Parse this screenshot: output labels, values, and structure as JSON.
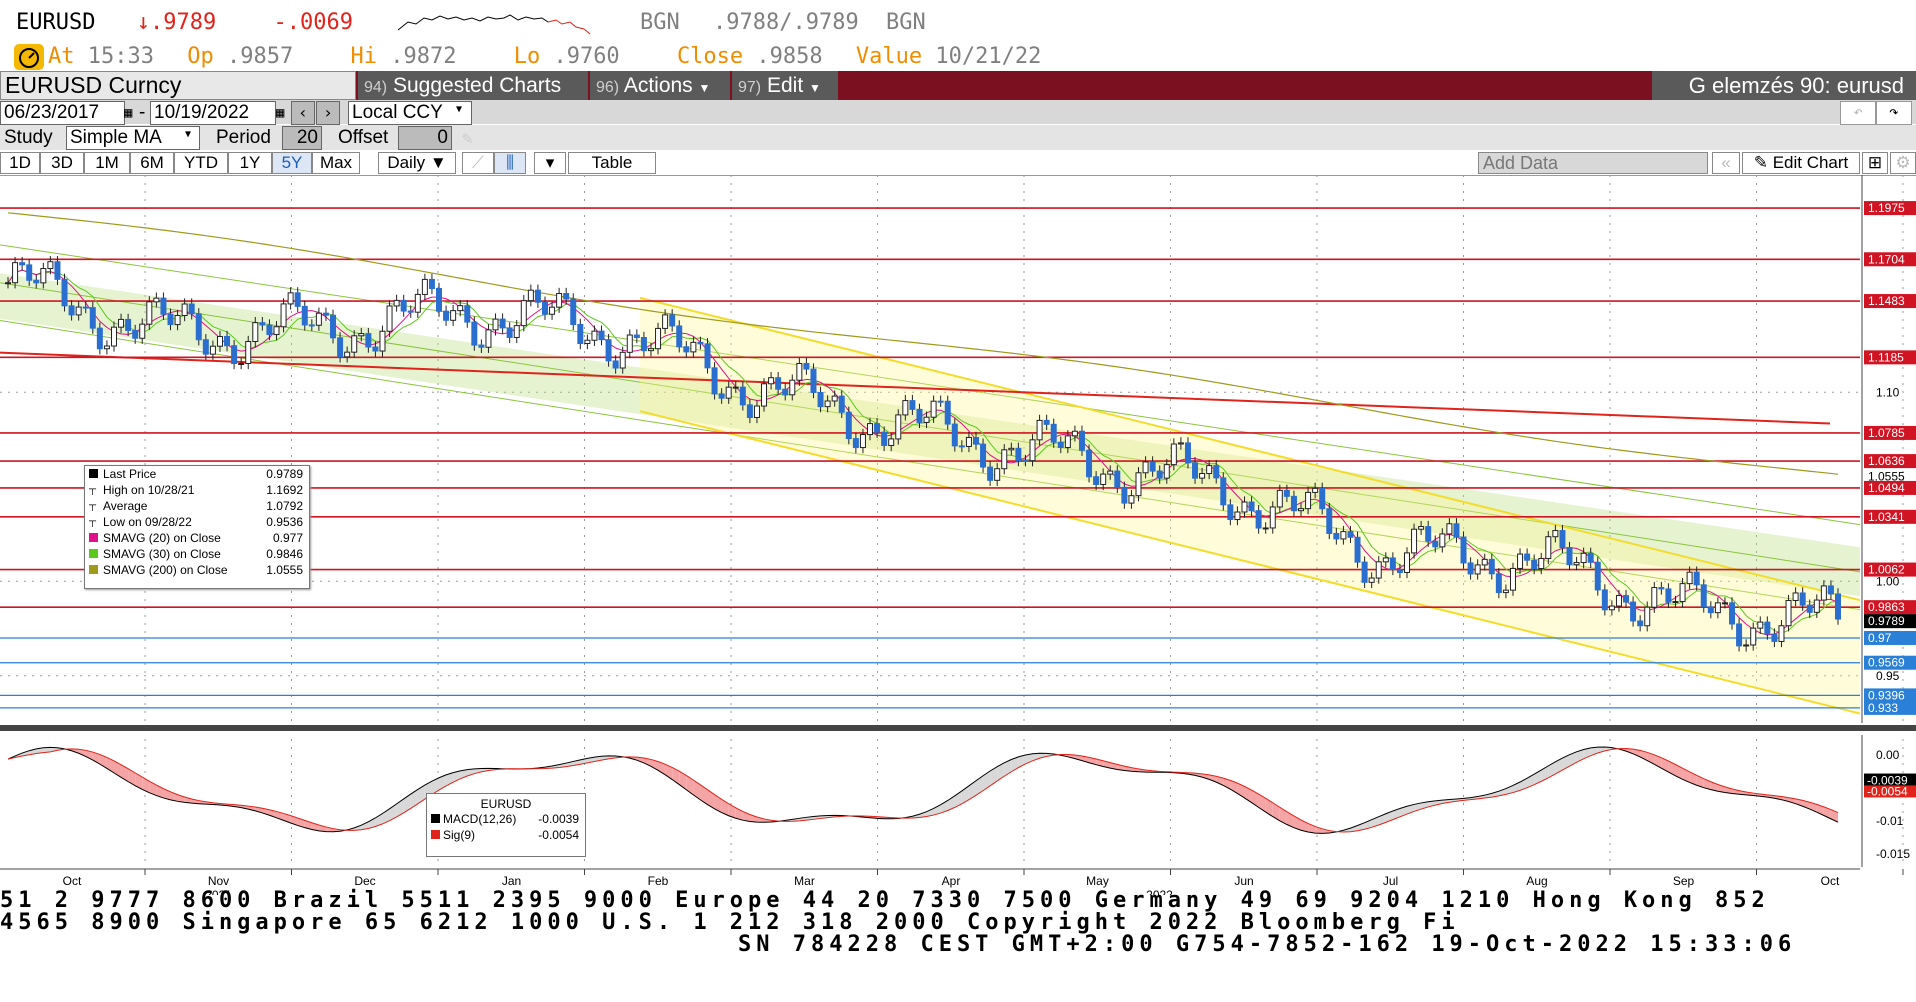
{
  "header": {
    "ticker": "EURUSD",
    "arrow": "↓",
    "last": ".9789",
    "change": "-.0069",
    "source1": "BGN",
    "bid": ".9788",
    "slash": "/",
    "ask": ".9789",
    "source2": "BGN",
    "at_label": "At",
    "at_time": "15:33",
    "op_label": "Op",
    "op_value": ".9857",
    "hi_label": "Hi",
    "hi_value": ".9872",
    "lo_label": "Lo",
    "lo_value": ".9760",
    "close_label": "Close",
    "close_value": ".9858",
    "value_label": "Value",
    "value_date": "10/21/22"
  },
  "menubar": {
    "security": "EURUSD Curncy",
    "suggested_num": "94)",
    "suggested": "Suggested Charts",
    "actions_num": "96)",
    "actions": "Actions",
    "edit_num": "97)",
    "edit": "Edit",
    "title": "G elemzés 90: eurusd"
  },
  "controls": {
    "start_date": "06/23/2017",
    "dash": "-",
    "end_date": "10/19/2022",
    "currency": "Local CCY",
    "study_label": "Study",
    "study_value": "Simple MA",
    "period_label": "Period",
    "period_value": "20",
    "offset_label": "Offset",
    "offset_value": "0"
  },
  "toolbar": {
    "ranges": [
      "1D",
      "3D",
      "1M",
      "6M",
      "YTD",
      "1Y",
      "5Y",
      "Max"
    ],
    "selected_range": "5Y",
    "frequency": "Daily",
    "table": "Table",
    "add_data_placeholder": "Add Data",
    "edit_chart": "Edit Chart"
  },
  "colors": {
    "accent_red": "#e0231b",
    "menu_bar": "#7b1020",
    "selected_tab": "#1c5fb8",
    "hline_red": "#d01423",
    "hline_blue": "#2a7fd6",
    "up_candle": "#1a1a1a",
    "down_candle": "#2a6fd0"
  },
  "chart_data": {
    "type": "line",
    "price_axis_ticks": [
      "1.10",
      "1.00",
      "0.95"
    ],
    "macd_axis_ticks": [
      "0.00",
      "-0.01",
      "-0.015"
    ],
    "x_tick_labels": [
      "Oct",
      "Nov",
      "Dec",
      "Jan",
      "Feb",
      "Mar",
      "Apr",
      "May",
      "Jun",
      "Jul",
      "Aug",
      "Sep",
      "Oct"
    ],
    "x_year_labels": [
      "2021",
      "2022"
    ],
    "horizontal_levels": [
      {
        "label": "1.1975",
        "value": 1.1975,
        "color": "red"
      },
      {
        "label": "1.1704",
        "value": 1.1704,
        "color": "red"
      },
      {
        "label": "1.1483",
        "value": 1.1483,
        "color": "red"
      },
      {
        "label": "1.1185",
        "value": 1.1185,
        "color": "red"
      },
      {
        "label": "1.0785",
        "value": 1.0785,
        "color": "red"
      },
      {
        "label": "1.0636",
        "value": 1.0636,
        "color": "red"
      },
      {
        "label": "1.0494",
        "value": 1.0494,
        "color": "red"
      },
      {
        "label": "1.0341",
        "value": 1.0341,
        "color": "red"
      },
      {
        "label": "1.0062",
        "value": 1.0062,
        "color": "red"
      },
      {
        "label": "0.9863",
        "value": 0.9863,
        "color": "red"
      },
      {
        "label": "0.97",
        "value": 0.97,
        "color": "blue"
      },
      {
        "label": "0.9569",
        "value": 0.9569,
        "color": "blue"
      },
      {
        "label": "0.9396",
        "value": 0.9396,
        "color": "blue"
      },
      {
        "label": "0.933",
        "value": 0.933,
        "color": "blue"
      }
    ],
    "price_labels_extra": [
      {
        "label": "1.0555",
        "value": 1.0555
      },
      {
        "label": "0.9789",
        "value": 0.9789
      }
    ],
    "close_series_monthly": {
      "months": [
        "Oct 2021",
        "Nov 2021",
        "Dec 2021",
        "Jan 2022",
        "Feb 2022",
        "Mar 2022",
        "Apr 2022",
        "May 2022",
        "Jun 2022",
        "Jul 2022",
        "Aug 2022",
        "Sep 2022",
        "Oct 2022"
      ],
      "values": [
        1.158,
        1.132,
        1.133,
        1.143,
        1.132,
        1.1,
        1.08,
        1.065,
        1.05,
        1.015,
        1.012,
        0.985,
        0.9789
      ]
    },
    "legend": [
      {
        "name": "Last Price",
        "value": "0.9789",
        "color": "#000000"
      },
      {
        "name": "High on 10/28/21",
        "value": "1.1692",
        "color": ""
      },
      {
        "name": "Average",
        "value": "1.0792",
        "color": ""
      },
      {
        "name": "Low on 09/28/22",
        "value": "0.9536",
        "color": ""
      },
      {
        "name": "SMAVG (20)  on Close",
        "value": "0.977",
        "color": "#e0118a"
      },
      {
        "name": "SMAVG (30)  on Close",
        "value": "0.9846",
        "color": "#5cc81e"
      },
      {
        "name": "SMAVG (200)  on Close",
        "value": "1.0555",
        "color": "#9e9a1c"
      }
    ],
    "macd_legend": {
      "title": "EURUSD",
      "items": [
        {
          "name": "MACD(12,26)",
          "value": "-0.0039",
          "color": "#000000"
        },
        {
          "name": "Sig(9)",
          "value": "-0.0054",
          "color": "#e0231b"
        }
      ]
    },
    "macd_labels": [
      "-0.0039",
      "-0.0054"
    ]
  },
  "footer": {
    "line1": "51 2 9777 8600 Brazil 5511 2395 9000 Europe 44 20 7330 7500 Germany 49 69 9204 1210 Hong Kong 852",
    "line2": " 4565 8900       Singapore 65 6212 1000       U.S. 1 212 318 2000       Copyright 2022 Bloomberg Fi",
    "line3": "SN 784228 CEST GMT+2:00 G754-7852-162 19-Oct-2022 15:33:06"
  }
}
